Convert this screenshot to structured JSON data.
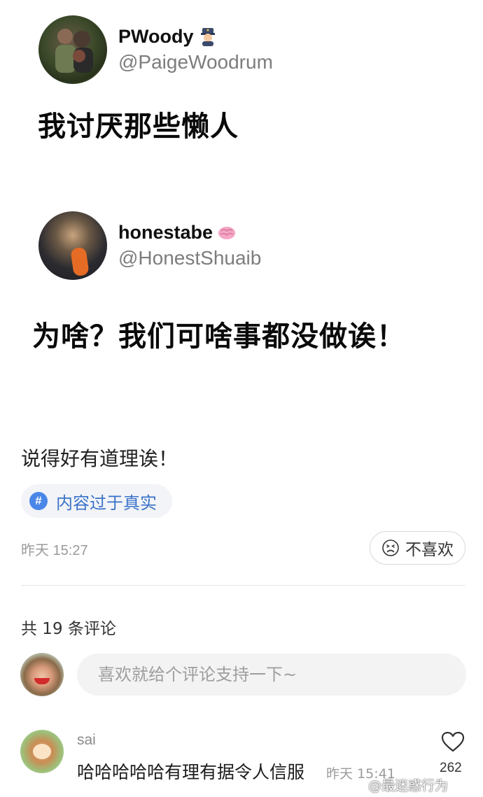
{
  "tweets": [
    {
      "display_name": "PWoody",
      "handle": "@PaigeWoodrum",
      "text": "我讨厌那些懒人",
      "badge_icon": "police-officer-emoji"
    },
    {
      "display_name": "honestabe",
      "handle": "@HonestShuaib",
      "text": "为啥？我们可啥事都没做诶！",
      "badge_icon": "brain-emoji"
    }
  ],
  "post": {
    "caption": "说得好有道理诶！",
    "topic": "内容过于真实",
    "timestamp": "昨天 15:27",
    "dislike_label": "不喜欢"
  },
  "comments": {
    "count_label": "共 19 条评论",
    "input_placeholder": "喜欢就给个评论支持一下~",
    "items": [
      {
        "username": "sai",
        "text": "哈哈哈哈哈有理有据令人信服",
        "time": "昨天 15:41",
        "likes": "262"
      }
    ]
  },
  "watermark": "@最迷惑行为",
  "colors": {
    "accent": "#4a86e8",
    "topic_text": "#3a72c8",
    "muted": "#9a9a9a"
  }
}
